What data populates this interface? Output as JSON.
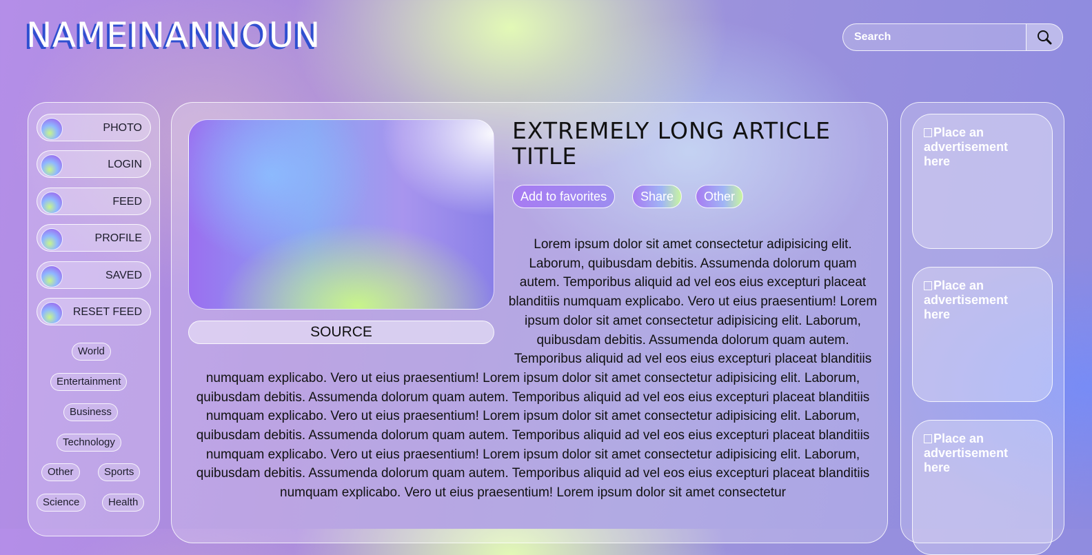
{
  "header": {
    "logo": "NAMEINANNOUN",
    "search_placeholder": "Search",
    "search_icon": "magnifier"
  },
  "nav": {
    "buttons": [
      {
        "label": "PHOTO"
      },
      {
        "label": "LOGIN"
      },
      {
        "label": "FEED"
      },
      {
        "label": "PROFILE"
      },
      {
        "label": "SAVED"
      },
      {
        "label": "RESET FEED"
      }
    ],
    "tags": [
      "World",
      "Entertainment",
      "Business",
      "Technology",
      "Other",
      "Sports",
      "Science",
      "Health"
    ]
  },
  "article": {
    "source_label": "SOURCE",
    "title": "EXTREMELY LONG ARTICLE TITLE",
    "actions": {
      "favorite": "Add to favorites",
      "share": "Share",
      "other": "Other"
    },
    "body": "Lorem ipsum dolor sit amet consectetur adipisicing elit. Laborum, quibusdam debitis. Assumenda dolorum quam autem. Temporibus aliquid ad vel eos eius excepturi placeat blanditiis numquam explicabo. Vero ut eius praesentium! Lorem ipsum dolor sit amet consectetur adipisicing elit. Laborum, quibusdam debitis. Assumenda dolorum quam autem. Temporibus aliquid ad vel eos eius excepturi placeat blanditiis numquam explicabo. Vero ut eius praesentium! Lorem ipsum dolor sit amet consectetur adipisicing elit. Laborum, quibusdam debitis. Assumenda dolorum quam autem. Temporibus aliquid ad vel eos eius excepturi placeat blanditiis numquam explicabo. Vero ut eius praesentium! Lorem ipsum dolor sit amet consectetur adipisicing elit. Laborum, quibusdam debitis. Assumenda dolorum quam autem. Temporibus aliquid ad vel eos eius excepturi placeat blanditiis numquam explicabo. Vero ut eius praesentium! Lorem ipsum dolor sit amet consectetur adipisicing elit. Laborum, quibusdam debitis. Assumenda dolorum quam autem. Temporibus aliquid ad vel eos eius excepturi placeat blanditiis numquam explicabo. Vero ut eius praesentium! Lorem ipsum dolor sit amet consectetur"
  },
  "ads": [
    {
      "alt": "Place an advertisement here"
    },
    {
      "alt": "Place an advertisement here"
    },
    {
      "alt": "Place an advertisement here"
    }
  ],
  "colors": {
    "logo_shadow": "#2f4fd0",
    "accent_purple": "#a77bf2",
    "accent_green": "#c8f58a"
  }
}
